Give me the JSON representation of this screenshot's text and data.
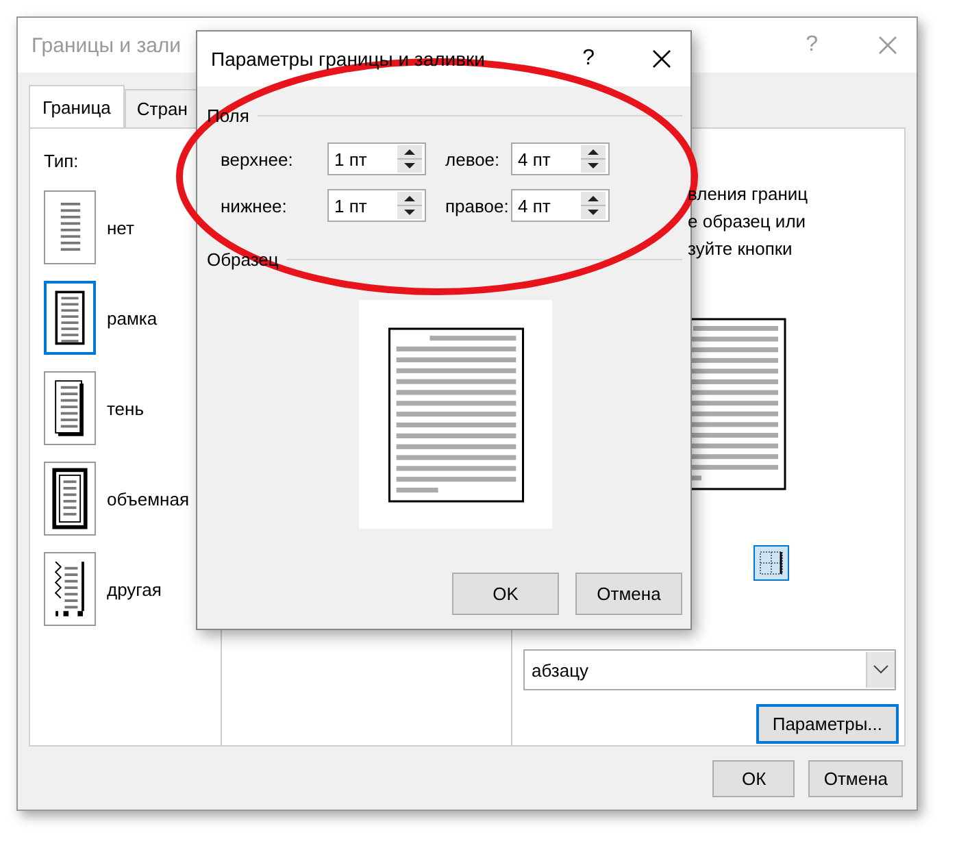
{
  "background_window": {
    "title": "Границы и зали",
    "help": "?",
    "tabs": [
      {
        "label": "Граница",
        "selected": true
      },
      {
        "label": "Стран",
        "selected": false
      }
    ],
    "type_label": "Тип:",
    "types": [
      {
        "kind": "none",
        "label": "нет",
        "selected": false
      },
      {
        "kind": "box",
        "label": "рамка",
        "selected": true
      },
      {
        "kind": "shadow",
        "label": "тень",
        "selected": false
      },
      {
        "kind": "raised",
        "label": "объемная",
        "selected": false
      },
      {
        "kind": "custom",
        "label": "другая",
        "selected": false
      }
    ],
    "hint_lines": [
      "вления границ",
      "е образец или",
      "зуйте кнопки"
    ],
    "apply_to": {
      "value": "абзацу"
    },
    "options_button": "Параметры...",
    "buttons": [
      "ОК",
      "Отмена"
    ]
  },
  "dialog": {
    "title": "Параметры границы и заливки",
    "help": "?",
    "margins_label": "Поля",
    "fields": [
      {
        "label": "верхнее:",
        "value": "1 пт"
      },
      {
        "label": "левое:",
        "value": "4 пт"
      },
      {
        "label": "нижнее:",
        "value": "1 пт"
      },
      {
        "label": "правое:",
        "value": "4 пт"
      }
    ],
    "preview_label": "Образец",
    "buttons": [
      "OK",
      "Отмена"
    ]
  }
}
